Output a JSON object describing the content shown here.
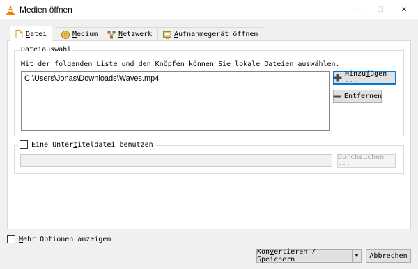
{
  "window": {
    "title": "Medien öffnen",
    "minimize_glyph": "—",
    "maximize_glyph": "☐",
    "close_glyph": "✕"
  },
  "tabs": [
    {
      "label_pre": "",
      "label_u": "D",
      "label_post": "atei",
      "icon": "file-icon",
      "active": true
    },
    {
      "label_pre": "",
      "label_u": "M",
      "label_post": "edium",
      "icon": "disc-icon",
      "active": false
    },
    {
      "label_pre": "",
      "label_u": "N",
      "label_post": "etzwerk",
      "icon": "network-icon",
      "active": false
    },
    {
      "label_pre": "",
      "label_u": "A",
      "label_post": "ufnahmegerät öffnen",
      "icon": "capture-device-icon",
      "active": false
    }
  ],
  "file_selection": {
    "legend": "Dateiauswahl",
    "description": "Mit der folgenden Liste und den Knöpfen können Sie lokale Dateien auswählen.",
    "files": [
      "C:\\Users\\Jonas\\Downloads\\Waves.mp4"
    ],
    "add_button": {
      "label_pre": "Hinzu",
      "label_u": "f",
      "label_post": "ügen ···"
    },
    "remove_button": {
      "label_pre": "",
      "label_u": "E",
      "label_post": "ntfernen"
    }
  },
  "subtitle": {
    "checkbox_label_pre": "Eine Unter",
    "checkbox_label_u": "t",
    "checkbox_label_post": "iteldatei benutzen",
    "checked": false,
    "path_value": "",
    "browse_button": "Durchsuchen ···"
  },
  "footer": {
    "more_options_pre": "",
    "more_options_u": "M",
    "more_options_post": "ehr Optionen anzeigen",
    "more_options_checked": false,
    "convert_button_pre": "Kon",
    "convert_button_u": "v",
    "convert_button_post": "ertieren / Speichern",
    "dropdown_glyph": "▼",
    "cancel_button_pre": "",
    "cancel_button_u": "A",
    "cancel_button_post": "bbrechen"
  },
  "colors": {
    "accent": "#0078d7",
    "vlc_orange": "#f08000"
  }
}
